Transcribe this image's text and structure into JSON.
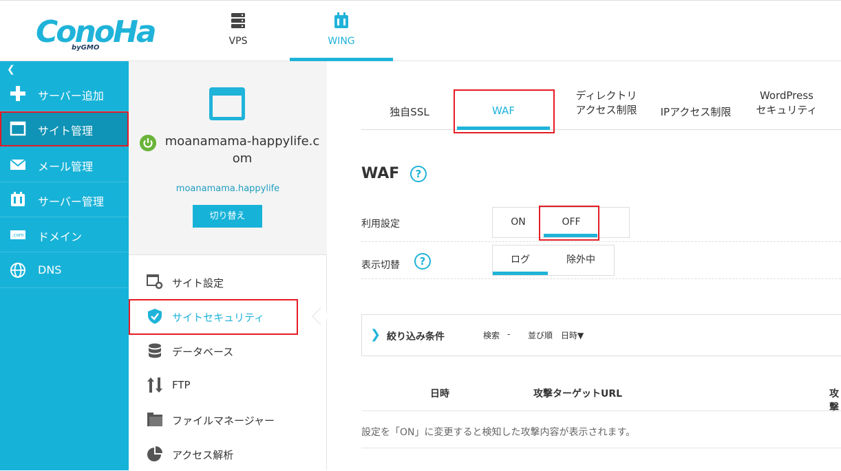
{
  "header": {
    "logo_text": "ConoHa",
    "logo_sub": "byGMO",
    "tabs": [
      {
        "label": "VPS",
        "icon": "server-icon"
      },
      {
        "label": "WING",
        "icon": "wing-icon"
      }
    ]
  },
  "sidebar": {
    "collapse": "❮",
    "items": [
      {
        "label": "サーバー追加",
        "icon": "plus-icon"
      },
      {
        "label": "サイト管理",
        "icon": "window-icon"
      },
      {
        "label": "メール管理",
        "icon": "mail-icon"
      },
      {
        "label": "サーバー管理",
        "icon": "server-manage-icon"
      },
      {
        "label": "ドメイン",
        "icon": "domain-icon",
        "icon_text": ".com"
      },
      {
        "label": "DNS",
        "icon": "globe-icon"
      }
    ]
  },
  "site": {
    "name": "moanamama-happylife.com",
    "sub": "moanamama.happylife",
    "switch_label": "切り替え"
  },
  "site_menu": [
    {
      "label": "サイト設定",
      "icon": "site-settings-icon"
    },
    {
      "label": "サイトセキュリティ",
      "icon": "shield-check-icon"
    },
    {
      "label": "データベース",
      "icon": "database-icon"
    },
    {
      "label": "FTP",
      "icon": "ftp-arrows-icon"
    },
    {
      "label": "ファイルマネージャー",
      "icon": "folder-icon"
    },
    {
      "label": "アクセス解析",
      "icon": "pie-chart-icon"
    }
  ],
  "security_tabs": {
    "ssl": "独自SSL",
    "waf": "WAF",
    "dir_line1": "ディレクトリ",
    "dir_line2": "アクセス制限",
    "ip": "IPアクセス制限",
    "wp_line1": "WordPress",
    "wp_line2": "セキュリティ"
  },
  "waf": {
    "title": "WAF",
    "help": "?",
    "usage_label": "利用設定",
    "on": "ON",
    "off": "OFF",
    "view_label": "表示切替",
    "log": "ログ",
    "excluded": "除外中"
  },
  "filter": {
    "chevron": "❯",
    "title": "絞り込み条件",
    "search_label": "検索",
    "search_value": "-",
    "sort_label": "並び順",
    "sort_value": "日時▼"
  },
  "table": {
    "headers": [
      "日時",
      "攻撃ターゲットURL",
      "攻撃"
    ],
    "empty_message": "設定を「ON」に変更すると検知した攻撃内容が表示されます。"
  },
  "colors": {
    "accent": "#1fb3d9",
    "sidebar": "#17b2d8",
    "highlight": "#e41b23",
    "power": "#6ab43a"
  }
}
